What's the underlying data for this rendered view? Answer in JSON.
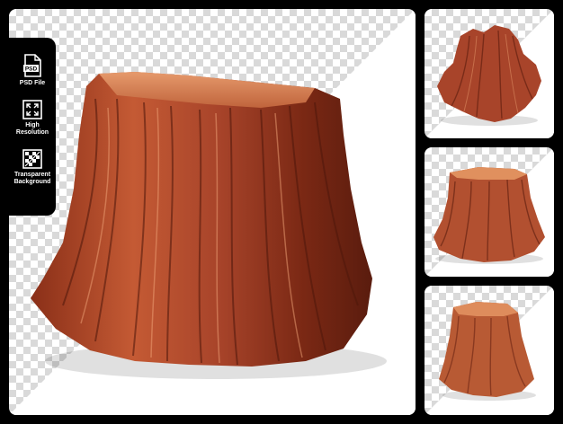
{
  "badges": [
    {
      "icon": "psd-file-icon",
      "label": "PSD File",
      "glyph": "PSD"
    },
    {
      "icon": "high-resolution-icon",
      "label": "High Resolution"
    },
    {
      "icon": "transparent-background-icon",
      "label": "Transparent Background"
    }
  ],
  "colors": {
    "background": "#000000",
    "checker": "#d9d9d9",
    "wood_dark": "#6b2414",
    "wood_mid": "#b4502e",
    "wood_light": "#e08a5e"
  },
  "images": [
    {
      "name": "main-tree-stump-image"
    },
    {
      "name": "thumbnail-stump-1"
    },
    {
      "name": "thumbnail-stump-2"
    },
    {
      "name": "thumbnail-stump-3"
    }
  ]
}
